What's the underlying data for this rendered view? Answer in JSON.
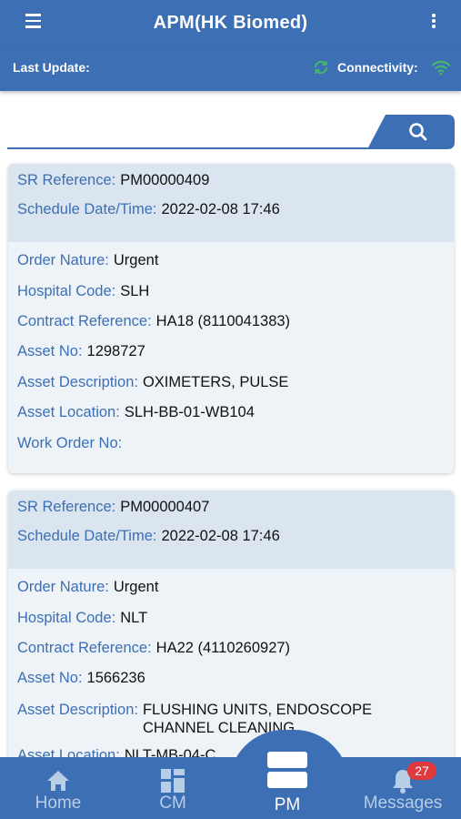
{
  "header": {
    "title": "APM(HK Biomed)"
  },
  "status": {
    "last_update_label": "Last Update:",
    "connectivity_label": "Connectivity:"
  },
  "search": {
    "value": "",
    "placeholder": ""
  },
  "labels": {
    "sr_reference": "SR Reference:",
    "schedule": "Schedule Date/Time:",
    "order_nature": "Order Nature:",
    "hospital_code": "Hospital Code:",
    "contract_reference": "Contract Reference:",
    "asset_no": "Asset No:",
    "asset_description": "Asset Description:",
    "asset_location": "Asset Location:",
    "work_order_no": "Work Order No:"
  },
  "cards": [
    {
      "sr_reference": "PM00000409",
      "schedule": "2022-02-08 17:46",
      "order_nature": "Urgent",
      "hospital_code": "SLH",
      "contract_reference": "HA18 (8110041383)",
      "asset_no": "1298727",
      "asset_description": "OXIMETERS, PULSE",
      "asset_location": "SLH-BB-01-WB104",
      "work_order_no": ""
    },
    {
      "sr_reference": "PM00000407",
      "schedule": "2022-02-08 17:46",
      "order_nature": "Urgent",
      "hospital_code": "NLT",
      "contract_reference": "HA22 (4110260927)",
      "asset_no": "1566236",
      "asset_description": "FLUSHING UNITS, ENDOSCOPE CHANNEL CLEANING",
      "asset_location": "NLT-MB-04-C"
    }
  ],
  "nav": {
    "home": "Home",
    "cm": "CM",
    "pm": "PM",
    "messages": "Messages",
    "messages_badge": "27",
    "active": "pm"
  },
  "colors": {
    "primary": "#3d6fb4",
    "card_head": "#dbe5ef",
    "card_body": "#eef3f8",
    "badge": "#e0393e",
    "sync": "#46b86a"
  },
  "icons": {
    "menu": "hamburger-menu-icon",
    "more": "more-vertical-icon",
    "sync": "sync-icon",
    "wifi": "wifi-icon",
    "search": "search-icon",
    "home": "home-icon",
    "cm": "grid-icon",
    "pm": "pm-icon",
    "messages": "bell-icon"
  }
}
